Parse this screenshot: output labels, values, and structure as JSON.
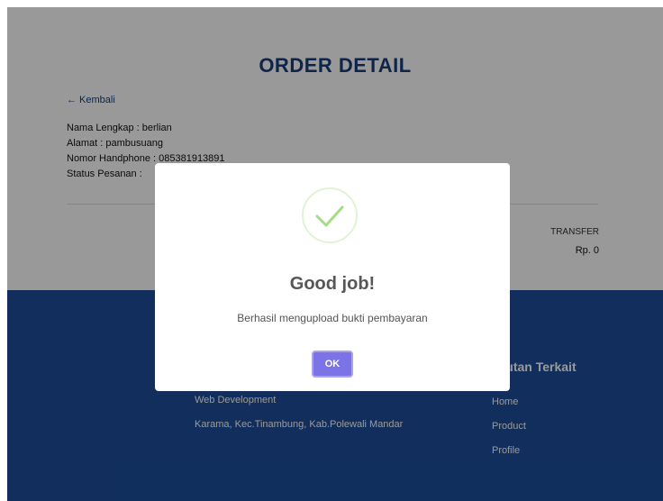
{
  "order": {
    "title": "ORDER DETAIL",
    "back_link": "← Kembali",
    "info": [
      "Nama Lengkap : berlian",
      "Alamat : pambusuang",
      "Nomor Handphone : 085381913891",
      "Status Pesanan :"
    ],
    "payment_method": "TRANSFER",
    "total": "Rp. 0"
  },
  "footer": {
    "col1": {
      "text_1": "Web Development",
      "text_2": "Karama, Kec.Tinambung, Kab.Polewali Mandar"
    },
    "col2": {
      "heading": "Tautan Terkait",
      "links": [
        "Home",
        "Product",
        "Profile"
      ]
    }
  },
  "modal": {
    "icon": "success-check-icon",
    "title": "Good job!",
    "text": "Berhasil mengupload bukti pembayaran",
    "ok_label": "OK"
  },
  "colors": {
    "title": "#1a3c7a",
    "footer_bg": "#1d4e9a",
    "ok_button": "#7c73e6",
    "success": "#a5dc86"
  }
}
